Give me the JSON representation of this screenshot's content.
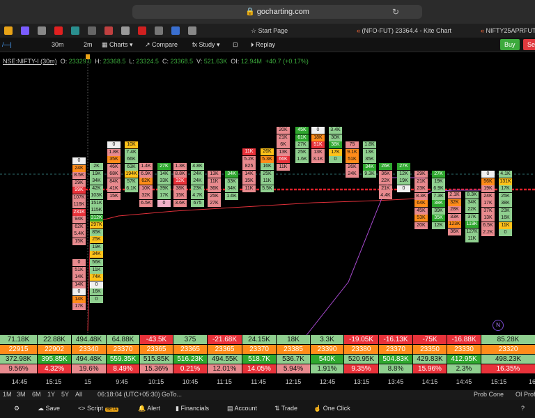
{
  "browser": {
    "url": "gocharting.com",
    "tabs": [
      "Start Page",
      "(NFO-FUT) 23364.4 - Kite Chart",
      "NIFTY25APRFUT |"
    ]
  },
  "toolbar": {
    "symbol_short": "/—|",
    "interval": "30m",
    "interval2": "2m",
    "charts": "Charts",
    "compare": "Compare",
    "study": "Study",
    "replay": "Replay",
    "buy": "Buy",
    "sell": "Sell"
  },
  "legend": {
    "symbol": "NSE:NIFTY-I (30m)",
    "o_label": "O:",
    "o": "23329.0",
    "h_label": "H:",
    "h": "23368.5",
    "l_label": "L:",
    "l": "23324.5",
    "c_label": "C:",
    "c": "23368.5",
    "v_label": "V:",
    "v": "521.63K",
    "oi_label": "OI:",
    "oi": "12.94M",
    "chg": "+40.7 (+0.17%)"
  },
  "colors": {
    "strong_red": "#e8323a",
    "light_red": "#e88a8e",
    "strong_green": "#2fa82f",
    "light_green": "#8fcf8f",
    "orange": "#ff8c1a",
    "yellow": "#ffc21a",
    "pink": "#f0b0c8",
    "white": "#f0f0f0"
  },
  "footprint_columns": [
    [
      "0",
      "24K",
      "8.5K",
      "29K",
      "99K",
      "107K",
      "116K",
      "231K",
      "94K",
      "62K",
      "5.4K",
      "15K"
    ],
    [
      "2K",
      "19K",
      "34K",
      "42K",
      "103K",
      "151K",
      "115K",
      "312K",
      "297K",
      "85K",
      "25K",
      "19K",
      "34K"
    ],
    [
      "0",
      "51K",
      "14K",
      "14K",
      "0",
      "14K",
      "17K"
    ],
    [
      "56K",
      "11K",
      "74K",
      "0",
      "16K",
      "0"
    ],
    [
      "0",
      "1.8K",
      "35K",
      "46K",
      "68K",
      "84K",
      "41K",
      "15K"
    ],
    [
      "10K",
      "7.4K",
      "66K",
      "63K",
      "194K",
      "57K",
      "6.1K"
    ],
    [
      "1.4K",
      "6.9K",
      "62K",
      "10K",
      "32K",
      "6.5K"
    ],
    [
      "27K",
      "14K",
      "33K",
      "39K",
      "17K",
      "0"
    ],
    [
      "1.3K",
      "8.8K",
      "32K",
      "38K",
      "15K",
      "3.6K"
    ],
    [
      "4.8K",
      "24K",
      "24K",
      "23K",
      "4.7K",
      "675"
    ],
    [
      "13K",
      "11K",
      "36K",
      "25K",
      "27K"
    ],
    [
      "34K",
      "33K",
      "34K",
      "1.6K"
    ],
    [
      "11K",
      "5.2K",
      "825",
      "14K",
      "15K",
      "11K"
    ],
    [
      "26K",
      "5.3K",
      "16K",
      "25K",
      "11K",
      "5.5K"
    ],
    [
      "20K",
      "21K",
      "6K",
      "13K",
      "66K",
      "11K"
    ],
    [
      "45K",
      "61K",
      "27K",
      "25K",
      "1.6K"
    ],
    [
      "0",
      "18K",
      "51K",
      "13K",
      "3.1K"
    ],
    [
      "3.4K",
      "30K",
      "38K",
      "17K",
      "0"
    ],
    [
      "75",
      "9.1K",
      "51K",
      "26K",
      "24K"
    ],
    [
      "1.8K",
      "13K",
      "35K",
      "34K",
      "9.3K"
    ],
    [
      "26K",
      "36K",
      "22K",
      "21K",
      "4.4K"
    ],
    [
      "27K",
      "12K",
      "19K",
      "0"
    ],
    [
      "29K",
      "21K",
      "23K",
      "8.3K",
      "64K",
      "45K",
      "53K",
      "20K"
    ],
    [
      "27K",
      "19K",
      "6.9K",
      "7.3K",
      "38K",
      "39K",
      "35K",
      "12K"
    ],
    [
      "2.1K",
      "32K",
      "28K",
      "33K",
      "123K",
      "36K"
    ],
    [
      "8.3K",
      "34K",
      "22K",
      "37K",
      "119K",
      "127K",
      "11K"
    ],
    [
      "0",
      "56K",
      "19K",
      "24K",
      "17K",
      "37K",
      "13K",
      "6.5K",
      "2.2K"
    ],
    [
      "4.1K",
      "131K",
      "17K",
      "25K",
      "38K",
      "23K",
      "16K",
      "11K",
      "0"
    ]
  ],
  "stats_rows": [
    [
      "71.18K",
      "22.88K",
      "494.48K",
      "64.88K",
      "-43.5K",
      "375",
      "-21.68K",
      "24.15K",
      "18K",
      "3.3K",
      "-19.05K",
      "-16.13K",
      "-75K",
      "-16.88K",
      "85.28K"
    ],
    [
      "22915",
      "22902",
      "23340",
      "23370",
      "23365",
      "23365",
      "23365",
      "23370",
      "23385",
      "23390",
      "23380",
      "23370",
      "23350",
      "23330",
      "23320"
    ],
    [
      "372.98K",
      "395.85K",
      "494.48K",
      "559.35K",
      "515.85K",
      "516.23K",
      "494.55K",
      "518.7K",
      "536.7K",
      "540K",
      "520.95K",
      "504.83K",
      "429.83K",
      "412.95K",
      "498.23K"
    ],
    [
      "9.56%",
      "4.32%",
      "19.6%",
      "8.49%",
      "15.36%",
      "0.21%",
      "12.01%",
      "14.05%",
      "5.94%",
      "1.91%",
      "9.35%",
      "8.8%",
      "15.96%",
      "2.3%",
      "16.35%"
    ]
  ],
  "x_axis": [
    "14:45",
    "15:15",
    "15",
    "9:45",
    "10:15",
    "10:45",
    "11:15",
    "11:45",
    "12:15",
    "12:45",
    "13:15",
    "13:45",
    "14:15",
    "14:45",
    "15:15",
    "16"
  ],
  "range_bar": {
    "ranges": [
      "1M",
      "3M",
      "6M",
      "1Y",
      "5Y",
      "All"
    ],
    "time": "06:18:04 (UTC+05:30)",
    "goto": "GoTo...",
    "prob_cone": "Prob Cone",
    "oi_profile": "OI Prof"
  },
  "bottom_bar": {
    "save": "Save",
    "script": "Script",
    "beta": "BETA",
    "alert": "Alert",
    "financials": "Financials",
    "account": "Account",
    "trade": "Trade",
    "one_click": "One Click"
  },
  "chart_badge": "N"
}
